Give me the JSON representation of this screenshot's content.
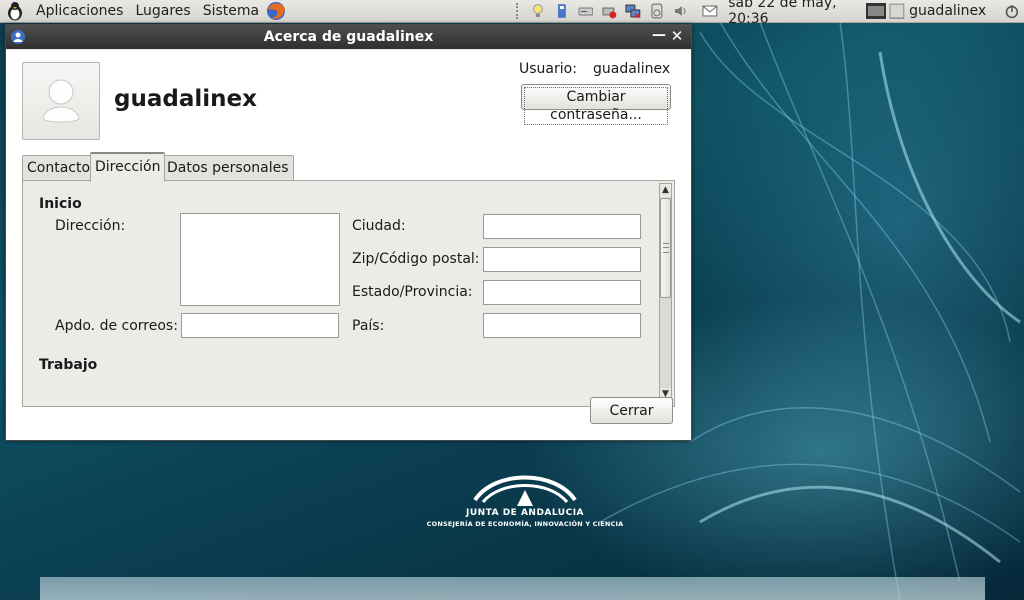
{
  "panel": {
    "menus": [
      "Aplicaciones",
      "Lugares",
      "Sistema"
    ],
    "clock": "sáb 22 de may, 20:36",
    "username": "guadalinex"
  },
  "dialog": {
    "title": "Acerca de guadalinex",
    "user_heading": "guadalinex",
    "usuario_label": "Usuario:",
    "usuario_value": "guadalinex",
    "change_password_label": "Cambiar contraseña...",
    "tabs": [
      "Contacto",
      "Dirección",
      "Datos personales"
    ],
    "active_tab": "Dirección",
    "sections": {
      "home": "Inicio",
      "work": "Trabajo"
    },
    "fields": {
      "direccion": {
        "label": "Dirección:",
        "value": ""
      },
      "apdo": {
        "label": "Apdo. de correos:",
        "value": ""
      },
      "ciudad": {
        "label": "Ciudad:",
        "value": ""
      },
      "zip": {
        "label": "Zip/Código postal:",
        "value": ""
      },
      "estado": {
        "label": "Estado/Provincia:",
        "value": ""
      },
      "pais": {
        "label": "País:",
        "value": ""
      }
    },
    "close_label": "Cerrar"
  },
  "desktop": {
    "logo_line1": "JUNTA DE ANDALUCIA",
    "logo_line2": "CONSEJERÍA DE ECONOMÍA, INNOVACIÓN Y CIENCIA"
  },
  "colors": {
    "titlebar": "#3a3a3a",
    "desktop_bg": "#0f5264",
    "panel_bg": "#e0ded8"
  }
}
